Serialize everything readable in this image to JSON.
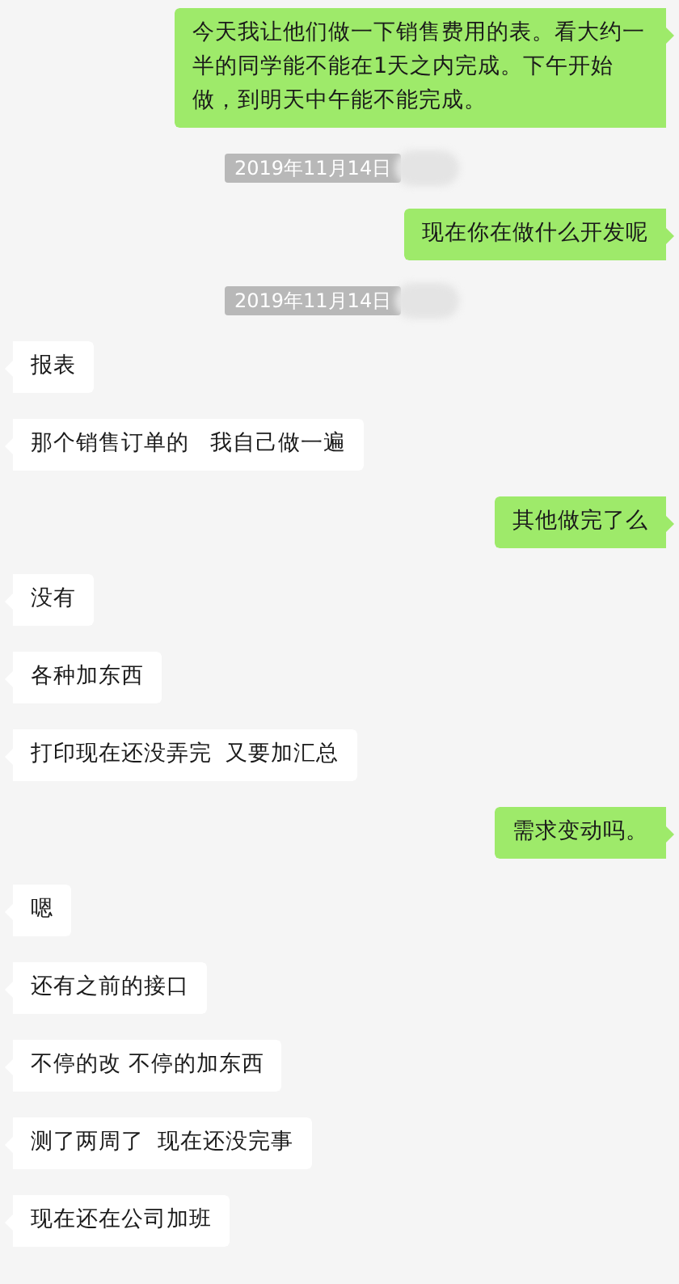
{
  "messages": [
    {
      "kind": "sent",
      "text": "今天我让他们做一下销售费用的表。看大约一半的同学能不能在1天之内完成。下午开始做，到明天中午能不能完成。"
    },
    {
      "kind": "time",
      "text": "2019年11月14日"
    },
    {
      "kind": "sent",
      "text": "现在你在做什么开发呢"
    },
    {
      "kind": "time",
      "text": "2019年11月14日"
    },
    {
      "kind": "received",
      "text": "报表"
    },
    {
      "kind": "received",
      "text": "那个销售订单的   我自己做一遍"
    },
    {
      "kind": "sent",
      "text": "其他做完了么"
    },
    {
      "kind": "received",
      "text": "没有"
    },
    {
      "kind": "received",
      "text": "各种加东西"
    },
    {
      "kind": "received",
      "text": "打印现在还没弄完  又要加汇总"
    },
    {
      "kind": "sent",
      "text": "需求变动吗。"
    },
    {
      "kind": "received",
      "text": "嗯"
    },
    {
      "kind": "received",
      "text": "还有之前的接口"
    },
    {
      "kind": "received",
      "text": "不停的改 不停的加东西"
    },
    {
      "kind": "received",
      "text": "测了两周了  现在还没完事"
    },
    {
      "kind": "received",
      "text": "现在还在公司加班"
    }
  ]
}
